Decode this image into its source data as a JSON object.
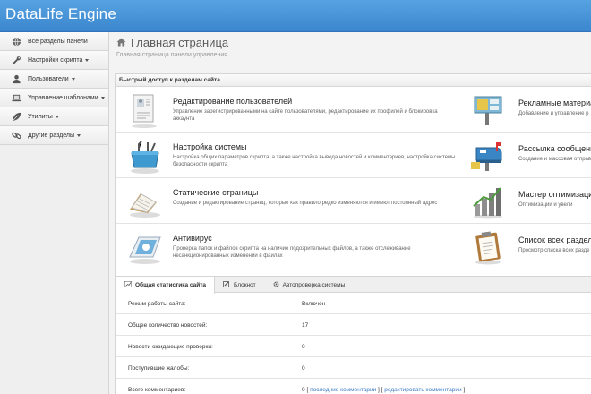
{
  "header": {
    "brand": "DataLife Engine"
  },
  "sidebar": {
    "items": [
      {
        "label": "Все разделы панели",
        "icon": "globe-icon",
        "caret": false
      },
      {
        "label": "Настройки скрипта",
        "icon": "wrench-icon",
        "caret": true
      },
      {
        "label": "Пользователи",
        "icon": "user-icon",
        "caret": true
      },
      {
        "label": "Управление шаблонами",
        "icon": "laptop-icon",
        "caret": true
      },
      {
        "label": "Утилиты",
        "icon": "leaf-icon",
        "caret": true
      },
      {
        "label": "Другие разделы",
        "icon": "link-icon",
        "caret": true
      }
    ]
  },
  "page": {
    "title": "Главная страница",
    "subtitle": "Главная страница панели управления"
  },
  "quick_access": {
    "heading": "Быстрый доступ к разделам сайта",
    "tiles": [
      {
        "title": "Редактирование пользователей",
        "desc": "Управление зарегистрированными на сайте пользователями, редактирование их профилей и блокировка аккаунта",
        "icon": "user-document-icon"
      },
      {
        "title": "Рекламные материа",
        "desc": "Добавление и управление р",
        "icon": "billboard-icon"
      },
      {
        "title": "Настройка системы",
        "desc": "Настройка общих параметров скрипта, а также настройка вывода новостей и комментариев, настройка системы безопасности скрипта",
        "icon": "toolbox-icon"
      },
      {
        "title": "Рассылка сообщени",
        "desc": "Создание и массовая отправ",
        "icon": "mailbox-icon"
      },
      {
        "title": "Статические страницы",
        "desc": "Создание и редактирование страниц, которые как правило редко изменяются и имеют постоянный адрес",
        "icon": "open-book-icon"
      },
      {
        "title": "Мастер оптимизации",
        "desc": "Оптимизации и увели",
        "icon": "bar-graph-icon"
      },
      {
        "title": "Антивирус",
        "desc": "Проверка папок и файлов скрипта на наличие подозрительных файлов, а также отслеживание несанкционированных изменений в файлах",
        "icon": "antivirus-icon"
      },
      {
        "title": "Список всех раздело",
        "desc": "Просмотр списка всех разде",
        "icon": "clipboard-icon"
      }
    ]
  },
  "stats": {
    "tabs": [
      {
        "label": "Общая статистика сайта",
        "icon": "chart-icon",
        "active": true
      },
      {
        "label": "Блокнот",
        "icon": "pencil-icon",
        "active": false
      },
      {
        "label": "Автопроверка системы",
        "icon": "gear-icon",
        "active": false
      }
    ],
    "rows": [
      {
        "key": "Режим работы сайта:",
        "value": "Включен"
      },
      {
        "key": "Общее количество новостей:",
        "value": "17"
      },
      {
        "key": "Новости ожидающие проверки:",
        "value": "0"
      },
      {
        "key": "Поступившие жалобы:",
        "value": "0"
      }
    ],
    "comments": {
      "key": "Всего комментариев:",
      "count": "0",
      "bracket_open": "[",
      "bracket_close": "]",
      "link_last": "последние комментарии",
      "link_edit": "редактировать комментарии"
    }
  },
  "colors": {
    "header": "#4a97da",
    "link": "#3a7ac2"
  }
}
